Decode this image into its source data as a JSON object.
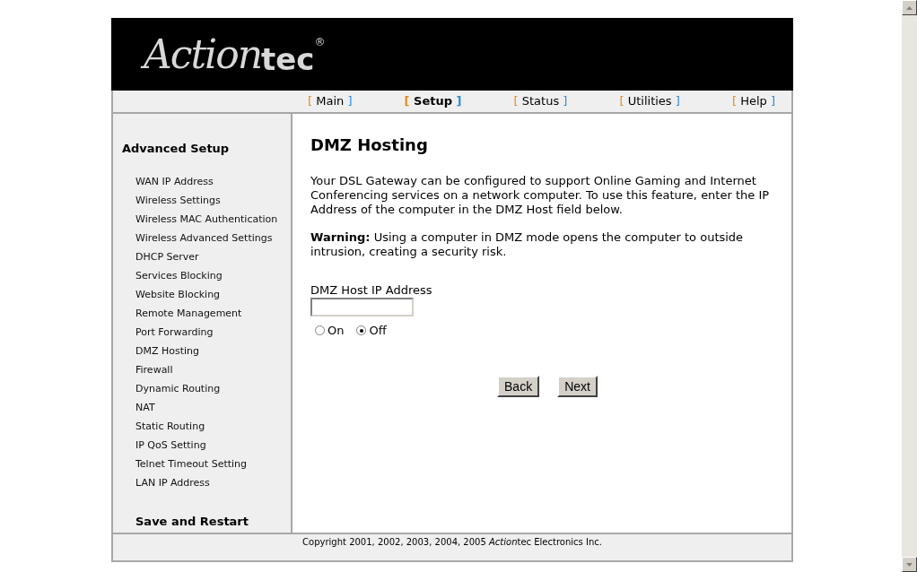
{
  "logo": {
    "script": "Action",
    "bold": "tec",
    "mark": "®"
  },
  "nav": [
    {
      "prefix": "[",
      "label": "Main",
      "suffix": "]",
      "selected": false
    },
    {
      "prefix": "[",
      "label": "Setup",
      "suffix": "]",
      "selected": true
    },
    {
      "prefix": "[",
      "label": "Status",
      "suffix": "]",
      "selected": false
    },
    {
      "prefix": "[",
      "label": "Utilities",
      "suffix": "]",
      "selected": false
    },
    {
      "prefix": "[",
      "label": "Help",
      "suffix": "]",
      "selected": false
    }
  ],
  "sidebar": {
    "title": "Advanced Setup",
    "items": [
      "WAN IP Address",
      "Wireless Settings",
      "Wireless MAC Authentication",
      "Wireless Advanced Settings",
      "DHCP Server",
      "Services Blocking",
      "Website Blocking",
      "Remote Management",
      "Port Forwarding",
      "DMZ Hosting",
      "Firewall",
      "Dynamic Routing",
      "NAT",
      "Static Routing",
      "IP QoS Setting",
      "Telnet Timeout Setting",
      "LAN IP Address"
    ],
    "footer_link": "Save and Restart"
  },
  "content": {
    "title": "DMZ Hosting",
    "paragraphs": [
      "Your DSL Gateway can be configured to support Online Gaming and Internet Conferencing services on a network computer. To use this feature, enter the IP Address of the computer in the DMZ Host field below.",
      "**Warning:** Using a computer in DMZ mode opens the computer to outside intrusion, creating a security risk."
    ],
    "field": {
      "label": "DMZ Host IP Address"
    },
    "radios": [
      {
        "label": "On",
        "selected": false
      },
      {
        "label": "Off",
        "selected": true
      }
    ],
    "buttons": [
      "Back",
      "Next"
    ]
  },
  "footer": {
    "before": "Copyright 2001, 2002, 2003, 2004, 2005 ",
    "italic": "Action",
    "after": "tec Electronics Inc."
  }
}
